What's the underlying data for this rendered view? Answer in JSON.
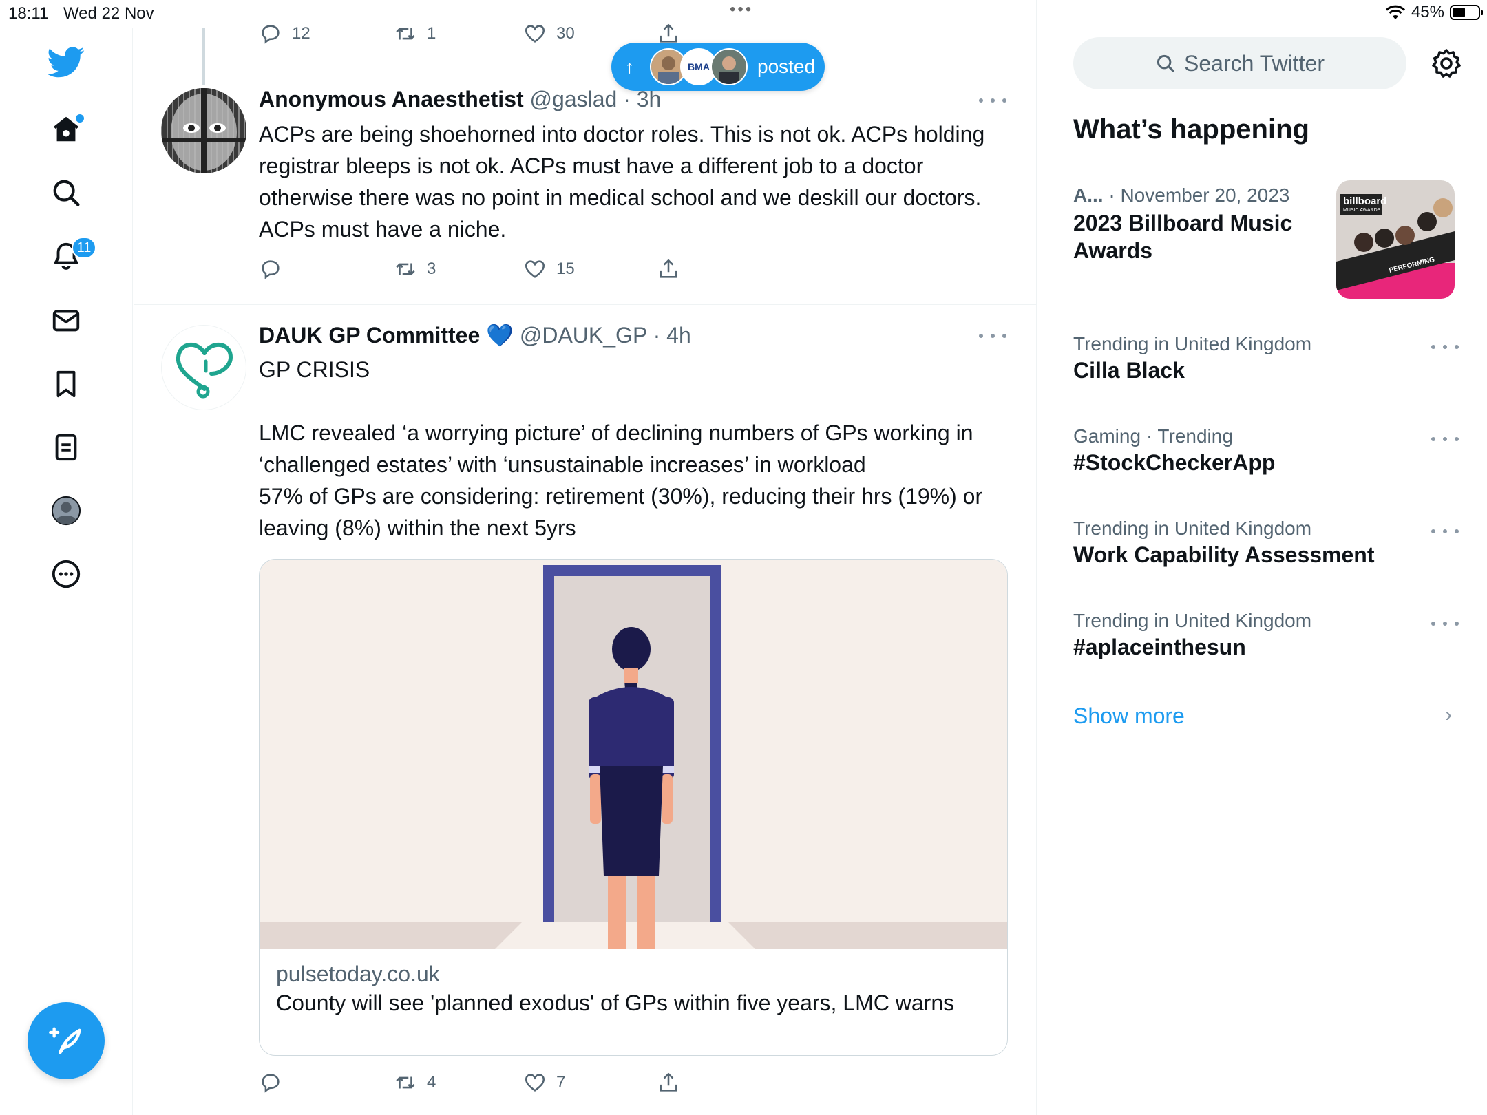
{
  "status_bar": {
    "time": "18:11",
    "date": "Wed 22 Nov",
    "battery": "45%"
  },
  "nav": {
    "notifications_badge": "11",
    "items": [
      "home",
      "explore",
      "notifications",
      "messages",
      "bookmarks",
      "lists",
      "profile",
      "more"
    ]
  },
  "pill": {
    "label": "posted",
    "avatar_text": "BMA"
  },
  "previous_tweet_actions": {
    "replies": "12",
    "retweets": "1",
    "likes": "30"
  },
  "tweets": [
    {
      "name": "Anonymous Anaesthetist",
      "handle": "@gaslad",
      "time": "· 3h",
      "text": "ACPs are being shoehorned into doctor roles. This is not ok. ACPs holding registrar bleeps is not ok. ACPs must have a different job to a doctor otherwise there was no point in medical school and we deskill our doctors. ACPs must have a niche.",
      "replies": "",
      "retweets": "3",
      "likes": "15"
    },
    {
      "name": "DAUK GP Committee",
      "emoji": "💙",
      "handle": "@DAUK_GP",
      "time": "· 4h",
      "text_line1": "GP CRISIS",
      "text_body": "LMC revealed ‘a worrying picture’ of declining numbers of GPs working in ‘challenged estates’ with ‘unsustainable increases’ in workload\n57% of GPs are considering: retirement (30%), reducing their hrs (19%) or leaving (8%) within the next 5yrs",
      "card": {
        "domain": "pulsetoday.co.uk",
        "title": "County will see 'planned exodus' of GPs within five years, LMC warns"
      },
      "replies": "",
      "retweets": "4",
      "likes": "7"
    }
  ],
  "sidebar": {
    "search_placeholder": "Search Twitter",
    "heading": "What’s happening",
    "featured": {
      "meta_source": "A...",
      "meta_date": "· November 20, 2023",
      "title": "2023 Billboard Music Awards",
      "thumb_label": "billboard",
      "thumb_sub": "MUSIC AWARDS",
      "thumb_banner": "PERFORMING"
    },
    "trends": [
      {
        "meta": "Trending in United Kingdom",
        "title": "Cilla Black"
      },
      {
        "meta": "Gaming · Trending",
        "title": "#StockCheckerApp"
      },
      {
        "meta": "Trending in United Kingdom",
        "title": "Work Capability Assessment"
      },
      {
        "meta": "Trending in United Kingdom",
        "title": "#aplaceinthesun"
      }
    ],
    "show_more": "Show more"
  },
  "colors": {
    "accent": "#1d9bf0",
    "text": "#0f1419",
    "muted": "#536471",
    "border": "#eff3f4"
  }
}
